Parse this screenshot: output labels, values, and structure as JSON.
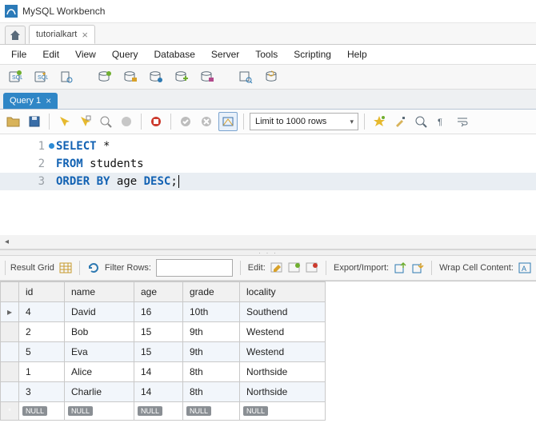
{
  "window": {
    "title": "MySQL Workbench"
  },
  "file_tab": {
    "label": "tutorialkart"
  },
  "menu": {
    "file": "File",
    "edit": "Edit",
    "view": "View",
    "query": "Query",
    "database": "Database",
    "server": "Server",
    "tools": "Tools",
    "scripting": "Scripting",
    "help": "Help"
  },
  "query_tab": {
    "label": "Query 1"
  },
  "editor_toolbar": {
    "limit_label": "Limit to 1000 rows"
  },
  "sql": {
    "lines": [
      {
        "n": "1",
        "tokens": [
          [
            "kw",
            "SELECT"
          ],
          [
            "sp",
            " "
          ],
          [
            "star",
            "*"
          ]
        ]
      },
      {
        "n": "2",
        "tokens": [
          [
            "kw",
            "FROM"
          ],
          [
            "sp",
            " "
          ],
          [
            "ident",
            "students"
          ]
        ]
      },
      {
        "n": "3",
        "tokens": [
          [
            "kw",
            "ORDER"
          ],
          [
            "sp",
            " "
          ],
          [
            "kw",
            "BY"
          ],
          [
            "sp",
            " "
          ],
          [
            "ident",
            "age"
          ],
          [
            "sp",
            " "
          ],
          [
            "kw",
            "DESC"
          ],
          [
            "ident",
            ";"
          ]
        ]
      }
    ]
  },
  "result_toolbar": {
    "result_grid": "Result Grid",
    "filter_rows": "Filter Rows:",
    "edit": "Edit:",
    "export_import": "Export/Import:",
    "wrap_cell": "Wrap Cell Content:"
  },
  "grid": {
    "headers": [
      "id",
      "name",
      "age",
      "grade",
      "locality"
    ],
    "rows": [
      {
        "id": "4",
        "name": "David",
        "age": "16",
        "grade": "10th",
        "locality": "Southend"
      },
      {
        "id": "2",
        "name": "Bob",
        "age": "15",
        "grade": "9th",
        "locality": "Westend"
      },
      {
        "id": "5",
        "name": "Eva",
        "age": "15",
        "grade": "9th",
        "locality": "Westend"
      },
      {
        "id": "1",
        "name": "Alice",
        "age": "14",
        "grade": "8th",
        "locality": "Northside"
      },
      {
        "id": "3",
        "name": "Charlie",
        "age": "14",
        "grade": "8th",
        "locality": "Northside"
      }
    ],
    "null_label": "NULL",
    "row_pointer": "▸",
    "new_row_marker": "*"
  }
}
